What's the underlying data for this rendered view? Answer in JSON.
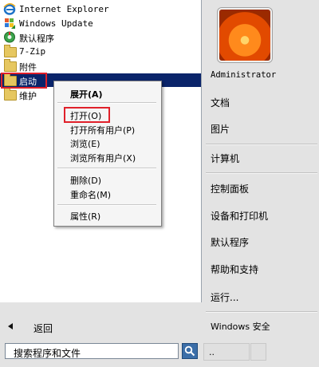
{
  "programs": [
    {
      "label": "Internet Explorer",
      "icon": "internet-explorer-icon"
    },
    {
      "label": "Windows Update",
      "icon": "windows-update-icon"
    },
    {
      "label": "默认程序",
      "icon": "default-programs-icon"
    },
    {
      "label": "7-Zip",
      "icon": "folder-icon"
    },
    {
      "label": "附件",
      "icon": "folder-icon"
    },
    {
      "label": "启动",
      "icon": "folder-icon"
    },
    {
      "label": "维护",
      "icon": "folder-icon"
    }
  ],
  "bottom": {
    "back_label": "返回",
    "search_placeholder": "搜索程序和文件"
  },
  "right": {
    "user": "Administrator",
    "documents": "文档",
    "pictures": "图片",
    "computer": "计算机",
    "control_panel": "控制面板",
    "devices_printers": "设备和打印机",
    "default_programs": "默认程序",
    "help_support": "帮助和支持",
    "run": "运行...",
    "security": "Windows 安全",
    "shutdown_label": ".."
  },
  "context_menu": {
    "expand": "展开(A)",
    "open": "打开(O)",
    "open_all_users": "打开所有用户(P)",
    "explore": "浏览(E)",
    "explore_all_users": "浏览所有用户(X)",
    "delete": "删除(D)",
    "rename": "重命名(M)",
    "properties": "属性(R)"
  },
  "colors": {
    "selection": "#0a246a",
    "highlight_box": "#e0202a"
  }
}
